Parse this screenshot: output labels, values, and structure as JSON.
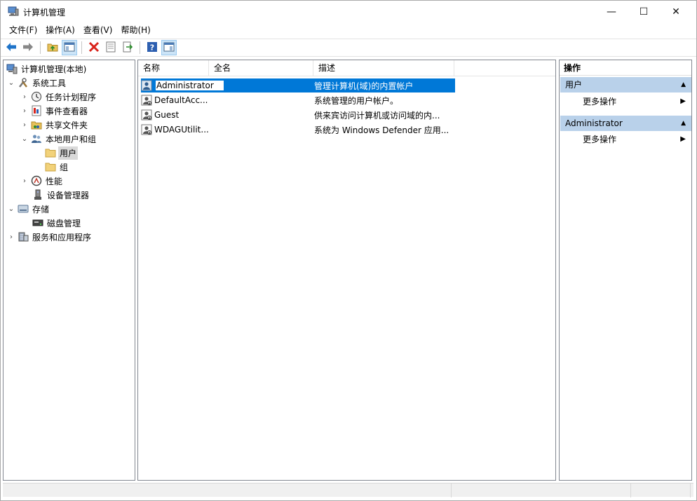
{
  "window": {
    "title": "计算机管理",
    "controls": {
      "minimize": "—",
      "maximize": "☐",
      "close": "✕"
    }
  },
  "menu": [
    {
      "label": "文件(F)"
    },
    {
      "label": "操作(A)"
    },
    {
      "label": "查看(V)"
    },
    {
      "label": "帮助(H)"
    }
  ],
  "toolbar": {
    "buttons": [
      "back-arrow-icon",
      "forward-arrow-icon",
      "up-folder-icon",
      "show-tree-icon",
      "delete-icon",
      "properties-icon",
      "export-icon",
      "help-icon",
      "show-action-pane-icon"
    ]
  },
  "tree": {
    "root": "计算机管理(本地)",
    "system_tools": "系统工具",
    "task_scheduler": "任务计划程序",
    "event_viewer": "事件查看器",
    "shared_folders": "共享文件夹",
    "local_users_groups": "本地用户和组",
    "users": "用户",
    "groups": "组",
    "performance": "性能",
    "device_manager": "设备管理器",
    "storage": "存储",
    "disk_management": "磁盘管理",
    "services_apps": "服务和应用程序"
  },
  "list": {
    "columns": [
      "名称",
      "全名",
      "描述"
    ],
    "rows": [
      {
        "name": "Administrator",
        "full_name": "",
        "description": "管理计算机(域)的内置帐户"
      },
      {
        "name": "DefaultAcc...",
        "full_name": "",
        "description": "系统管理的用户帐户。"
      },
      {
        "name": "Guest",
        "full_name": "",
        "description": "供来宾访问计算机或访问域的内..."
      },
      {
        "name": "WDAGUtilit...",
        "full_name": "",
        "description": "系统为 Windows Defender 应用..."
      }
    ]
  },
  "actions": {
    "title": "操作",
    "group1": "用户",
    "group1_more": "更多操作",
    "group2": "Administrator",
    "group2_more": "更多操作"
  },
  "colors": {
    "selection": "#0078d7",
    "action_group": "#b9d1ea",
    "tree_selected": "#d9d9d9"
  }
}
